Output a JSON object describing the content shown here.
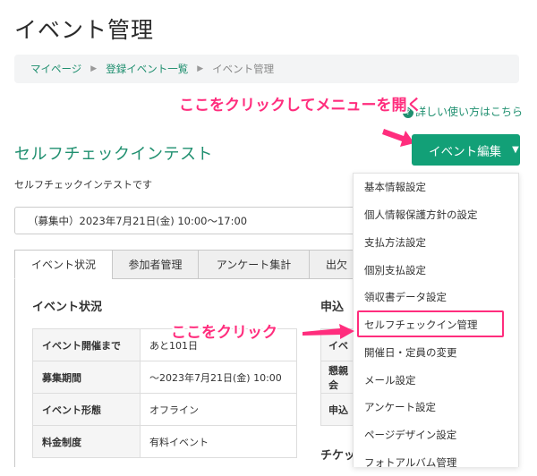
{
  "page": {
    "title": "イベント管理"
  },
  "breadcrumb": {
    "items": [
      "マイページ",
      "登録イベント一覧",
      "イベント管理"
    ]
  },
  "help": {
    "label": "詳しい使い方はこちら",
    "icon": "question-circle-icon"
  },
  "event": {
    "name": "セルフチェックインテスト",
    "description": "セルフチェックインテストです",
    "status_line": "（募集中）2023年7月21日(金) 10:00〜17:00"
  },
  "edit_button": {
    "label": "イベント編集",
    "caret": "▼"
  },
  "tabs": [
    "イベント状況",
    "参加者管理",
    "アンケート集計",
    "出欠"
  ],
  "status_section": {
    "title": "イベント状況",
    "rows": [
      {
        "key": "イベント開催まで",
        "value": "あと101日"
      },
      {
        "key": "募集期間",
        "value": "〜2023年7月21日(金) 10:00"
      },
      {
        "key": "イベント形態",
        "value": "オフライン"
      },
      {
        "key": "料金制度",
        "value": "有料イベント"
      }
    ]
  },
  "right_section": {
    "title": "申込",
    "rows": [
      "イベ",
      "懇親会",
      "申込"
    ],
    "title2": "チケッ"
  },
  "menu": {
    "items": [
      "基本情報設定",
      "個人情報保護方針の設定",
      "支払方法設定",
      "個別支払設定",
      "領収書データ設定",
      "セルフチェックイン管理",
      "開催日・定員の変更",
      "メール設定",
      "アンケート設定",
      "ページデザイン設定",
      "フォトアルバム管理"
    ]
  },
  "annotations": {
    "open_menu": "ここをクリックしてメニューを開く",
    "click_here": "ここをクリック"
  },
  "colors": {
    "accent": "#12a077",
    "link": "#1f8f6f",
    "annotation": "#ff2d7d"
  }
}
